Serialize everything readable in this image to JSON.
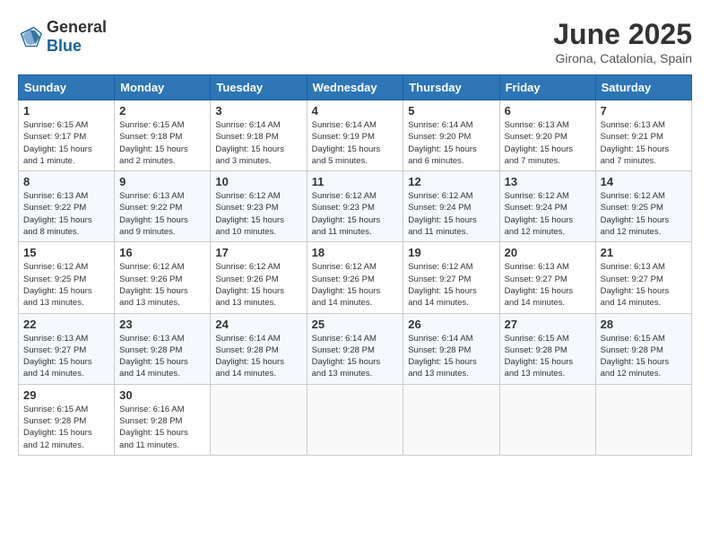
{
  "header": {
    "logo_general": "General",
    "logo_blue": "Blue",
    "month_title": "June 2025",
    "location": "Girona, Catalonia, Spain"
  },
  "weekdays": [
    "Sunday",
    "Monday",
    "Tuesday",
    "Wednesday",
    "Thursday",
    "Friday",
    "Saturday"
  ],
  "weeks": [
    [
      {
        "day": "1",
        "info": "Sunrise: 6:15 AM\nSunset: 9:17 PM\nDaylight: 15 hours\nand 1 minute."
      },
      {
        "day": "2",
        "info": "Sunrise: 6:15 AM\nSunset: 9:18 PM\nDaylight: 15 hours\nand 2 minutes."
      },
      {
        "day": "3",
        "info": "Sunrise: 6:14 AM\nSunset: 9:18 PM\nDaylight: 15 hours\nand 3 minutes."
      },
      {
        "day": "4",
        "info": "Sunrise: 6:14 AM\nSunset: 9:19 PM\nDaylight: 15 hours\nand 5 minutes."
      },
      {
        "day": "5",
        "info": "Sunrise: 6:14 AM\nSunset: 9:20 PM\nDaylight: 15 hours\nand 6 minutes."
      },
      {
        "day": "6",
        "info": "Sunrise: 6:13 AM\nSunset: 9:20 PM\nDaylight: 15 hours\nand 7 minutes."
      },
      {
        "day": "7",
        "info": "Sunrise: 6:13 AM\nSunset: 9:21 PM\nDaylight: 15 hours\nand 7 minutes."
      }
    ],
    [
      {
        "day": "8",
        "info": "Sunrise: 6:13 AM\nSunset: 9:22 PM\nDaylight: 15 hours\nand 8 minutes."
      },
      {
        "day": "9",
        "info": "Sunrise: 6:13 AM\nSunset: 9:22 PM\nDaylight: 15 hours\nand 9 minutes."
      },
      {
        "day": "10",
        "info": "Sunrise: 6:12 AM\nSunset: 9:23 PM\nDaylight: 15 hours\nand 10 minutes."
      },
      {
        "day": "11",
        "info": "Sunrise: 6:12 AM\nSunset: 9:23 PM\nDaylight: 15 hours\nand 11 minutes."
      },
      {
        "day": "12",
        "info": "Sunrise: 6:12 AM\nSunset: 9:24 PM\nDaylight: 15 hours\nand 11 minutes."
      },
      {
        "day": "13",
        "info": "Sunrise: 6:12 AM\nSunset: 9:24 PM\nDaylight: 15 hours\nand 12 minutes."
      },
      {
        "day": "14",
        "info": "Sunrise: 6:12 AM\nSunset: 9:25 PM\nDaylight: 15 hours\nand 12 minutes."
      }
    ],
    [
      {
        "day": "15",
        "info": "Sunrise: 6:12 AM\nSunset: 9:25 PM\nDaylight: 15 hours\nand 13 minutes."
      },
      {
        "day": "16",
        "info": "Sunrise: 6:12 AM\nSunset: 9:26 PM\nDaylight: 15 hours\nand 13 minutes."
      },
      {
        "day": "17",
        "info": "Sunrise: 6:12 AM\nSunset: 9:26 PM\nDaylight: 15 hours\nand 13 minutes."
      },
      {
        "day": "18",
        "info": "Sunrise: 6:12 AM\nSunset: 9:26 PM\nDaylight: 15 hours\nand 14 minutes."
      },
      {
        "day": "19",
        "info": "Sunrise: 6:12 AM\nSunset: 9:27 PM\nDaylight: 15 hours\nand 14 minutes."
      },
      {
        "day": "20",
        "info": "Sunrise: 6:13 AM\nSunset: 9:27 PM\nDaylight: 15 hours\nand 14 minutes."
      },
      {
        "day": "21",
        "info": "Sunrise: 6:13 AM\nSunset: 9:27 PM\nDaylight: 15 hours\nand 14 minutes."
      }
    ],
    [
      {
        "day": "22",
        "info": "Sunrise: 6:13 AM\nSunset: 9:27 PM\nDaylight: 15 hours\nand 14 minutes."
      },
      {
        "day": "23",
        "info": "Sunrise: 6:13 AM\nSunset: 9:28 PM\nDaylight: 15 hours\nand 14 minutes."
      },
      {
        "day": "24",
        "info": "Sunrise: 6:14 AM\nSunset: 9:28 PM\nDaylight: 15 hours\nand 14 minutes."
      },
      {
        "day": "25",
        "info": "Sunrise: 6:14 AM\nSunset: 9:28 PM\nDaylight: 15 hours\nand 13 minutes."
      },
      {
        "day": "26",
        "info": "Sunrise: 6:14 AM\nSunset: 9:28 PM\nDaylight: 15 hours\nand 13 minutes."
      },
      {
        "day": "27",
        "info": "Sunrise: 6:15 AM\nSunset: 9:28 PM\nDaylight: 15 hours\nand 13 minutes."
      },
      {
        "day": "28",
        "info": "Sunrise: 6:15 AM\nSunset: 9:28 PM\nDaylight: 15 hours\nand 12 minutes."
      }
    ],
    [
      {
        "day": "29",
        "info": "Sunrise: 6:15 AM\nSunset: 9:28 PM\nDaylight: 15 hours\nand 12 minutes."
      },
      {
        "day": "30",
        "info": "Sunrise: 6:16 AM\nSunset: 9:28 PM\nDaylight: 15 hours\nand 11 minutes."
      },
      {
        "day": "",
        "info": ""
      },
      {
        "day": "",
        "info": ""
      },
      {
        "day": "",
        "info": ""
      },
      {
        "day": "",
        "info": ""
      },
      {
        "day": "",
        "info": ""
      }
    ]
  ]
}
